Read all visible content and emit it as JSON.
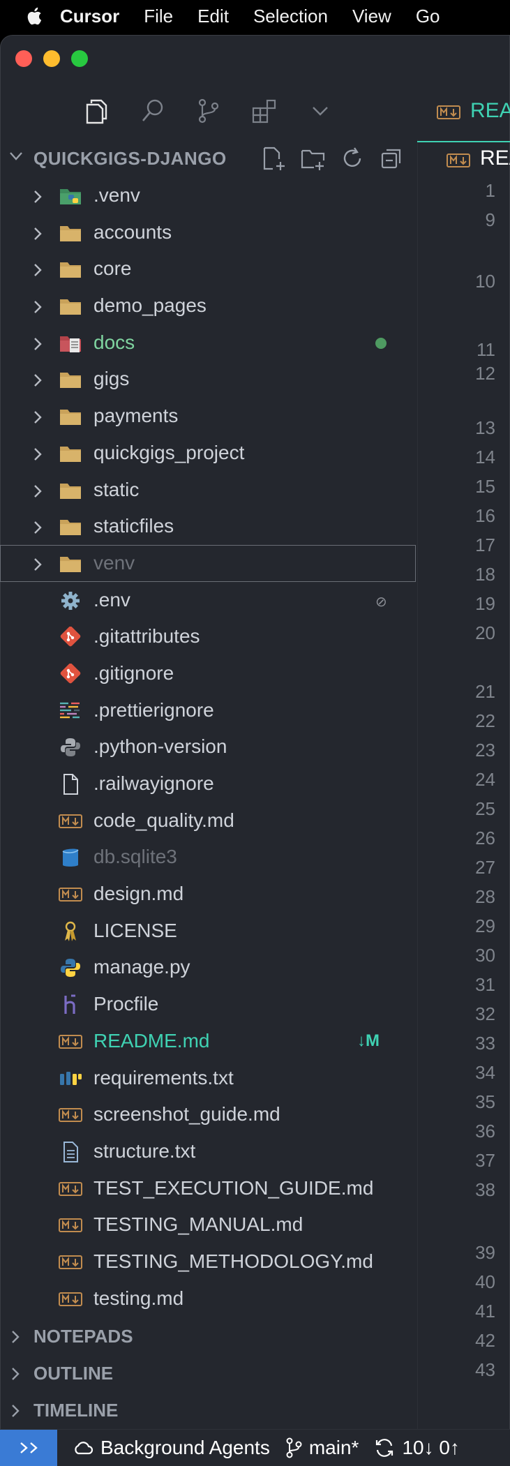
{
  "menubar": {
    "app_name": "Cursor",
    "items": [
      "File",
      "Edit",
      "Selection",
      "View",
      "Go"
    ]
  },
  "editor": {
    "tab_label": "REA",
    "breadcrumb_label": "REA",
    "line_numbers": [
      "1",
      "9",
      "10",
      "11",
      "12",
      "13",
      "14",
      "15",
      "16",
      "17",
      "18",
      "19",
      "20",
      "21",
      "22",
      "23",
      "24",
      "25",
      "26",
      "27",
      "28",
      "29",
      "30",
      "31",
      "32",
      "33",
      "34",
      "35",
      "36",
      "37",
      "38",
      "39",
      "40",
      "41",
      "42",
      "43"
    ]
  },
  "explorer": {
    "title": "QUICKGIGS-DJANGO",
    "items": [
      {
        "name": ".venv",
        "kind": "folder",
        "icon": "python-folder-icon"
      },
      {
        "name": "accounts",
        "kind": "folder",
        "icon": "folder-icon"
      },
      {
        "name": "core",
        "kind": "folder",
        "icon": "folder-icon"
      },
      {
        "name": "demo_pages",
        "kind": "folder",
        "icon": "folder-icon"
      },
      {
        "name": "docs",
        "kind": "folder",
        "icon": "docs-folder-icon",
        "status": "modified-dot"
      },
      {
        "name": "gigs",
        "kind": "folder",
        "icon": "folder-icon"
      },
      {
        "name": "payments",
        "kind": "folder",
        "icon": "folder-icon"
      },
      {
        "name": "quickgigs_project",
        "kind": "folder",
        "icon": "folder-icon"
      },
      {
        "name": "static",
        "kind": "folder",
        "icon": "folder-icon"
      },
      {
        "name": "staticfiles",
        "kind": "folder",
        "icon": "folder-icon"
      },
      {
        "name": "venv",
        "kind": "folder",
        "icon": "folder-icon",
        "state": "selected-ignored"
      },
      {
        "name": ".env",
        "kind": "file",
        "icon": "gear-icon",
        "status": "ignored"
      },
      {
        "name": ".gitattributes",
        "kind": "file",
        "icon": "git-icon"
      },
      {
        "name": ".gitignore",
        "kind": "file",
        "icon": "git-icon"
      },
      {
        "name": ".prettierignore",
        "kind": "file",
        "icon": "prettier-icon"
      },
      {
        "name": ".python-version",
        "kind": "file",
        "icon": "python-grey-icon"
      },
      {
        "name": ".railwayignore",
        "kind": "file",
        "icon": "blank-file-icon"
      },
      {
        "name": "code_quality.md",
        "kind": "file",
        "icon": "markdown-icon"
      },
      {
        "name": "db.sqlite3",
        "kind": "file",
        "icon": "database-icon",
        "state": "dimmed"
      },
      {
        "name": "design.md",
        "kind": "file",
        "icon": "markdown-icon"
      },
      {
        "name": "LICENSE",
        "kind": "file",
        "icon": "license-icon"
      },
      {
        "name": "manage.py",
        "kind": "file",
        "icon": "python-icon"
      },
      {
        "name": "Procfile",
        "kind": "file",
        "icon": "heroku-icon"
      },
      {
        "name": "README.md",
        "kind": "file",
        "icon": "markdown-icon",
        "badge": "↓M",
        "state": "modified"
      },
      {
        "name": "requirements.txt",
        "kind": "file",
        "icon": "pip-icon"
      },
      {
        "name": "screenshot_guide.md",
        "kind": "file",
        "icon": "markdown-icon"
      },
      {
        "name": "structure.txt",
        "kind": "file",
        "icon": "text-file-icon"
      },
      {
        "name": "TEST_EXECUTION_GUIDE.md",
        "kind": "file",
        "icon": "markdown-icon"
      },
      {
        "name": "TESTING_MANUAL.md",
        "kind": "file",
        "icon": "markdown-icon"
      },
      {
        "name": "TESTING_METHODOLOGY.md",
        "kind": "file",
        "icon": "markdown-icon"
      },
      {
        "name": "testing.md",
        "kind": "file",
        "icon": "markdown-icon"
      }
    ]
  },
  "sections": [
    "NOTEPADS",
    "OUTLINE",
    "TIMELINE"
  ],
  "statusbar": {
    "agents": "Background Agents",
    "branch": "main*",
    "sync": "10↓ 0↑"
  },
  "colors": {
    "accent": "#3fd2b3",
    "sidebar_bg": "#24272e",
    "folder": "#c9a25a",
    "modified_green": "#7fd4a0",
    "remote_blue": "#3a7bd5"
  }
}
